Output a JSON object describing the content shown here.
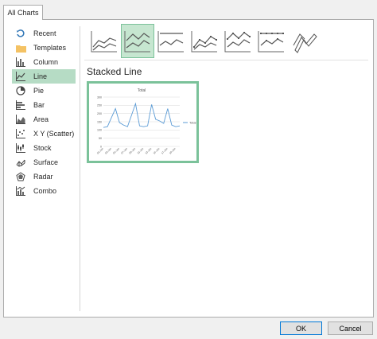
{
  "tab": {
    "label": "All Charts"
  },
  "sidebar": {
    "items": [
      {
        "label": "Recent",
        "icon": "recent-icon"
      },
      {
        "label": "Templates",
        "icon": "folder-icon"
      },
      {
        "label": "Column",
        "icon": "column-chart-icon"
      },
      {
        "label": "Line",
        "icon": "line-chart-icon",
        "selected": true
      },
      {
        "label": "Pie",
        "icon": "pie-chart-icon"
      },
      {
        "label": "Bar",
        "icon": "bar-chart-icon"
      },
      {
        "label": "Area",
        "icon": "area-chart-icon"
      },
      {
        "label": "X Y (Scatter)",
        "icon": "scatter-chart-icon"
      },
      {
        "label": "Stock",
        "icon": "stock-chart-icon"
      },
      {
        "label": "Surface",
        "icon": "surface-chart-icon"
      },
      {
        "label": "Radar",
        "icon": "radar-chart-icon"
      },
      {
        "label": "Combo",
        "icon": "combo-chart-icon"
      }
    ]
  },
  "subtype": {
    "title": "Stacked Line"
  },
  "preview": {
    "chart_data": {
      "type": "line",
      "title": "Total",
      "legend": "right",
      "series": [
        {
          "name": "Total",
          "values": [
            115,
            120,
            175,
            230,
            145,
            130,
            120,
            190,
            260,
            125,
            120,
            125,
            255,
            165,
            155,
            140,
            230,
            130,
            120,
            125
          ]
        }
      ],
      "categories": [
        "01-Jan",
        "02-Jan",
        "03-Jan",
        "04-Jan",
        "05-Jan",
        "06-Jan",
        "07-Jan",
        "08-Jan",
        "09-Jan",
        "10-Jan",
        "11-Jan",
        "12-Jan",
        "13-Jan",
        "14-Jan",
        "15-Jan",
        "16-Jan",
        "17-Jan",
        "18-Jan",
        "19-Jan",
        "20-Jan"
      ],
      "yticks": [
        "0",
        "50",
        "100",
        "150",
        "200",
        "250",
        "300"
      ],
      "ylim": [
        0,
        300
      ],
      "color": "#5b9bd5"
    }
  },
  "buttons": {
    "ok": "OK",
    "cancel": "Cancel"
  },
  "colors": {
    "accent": "#7bc29a",
    "selected_bg": "#b6dcc5"
  }
}
